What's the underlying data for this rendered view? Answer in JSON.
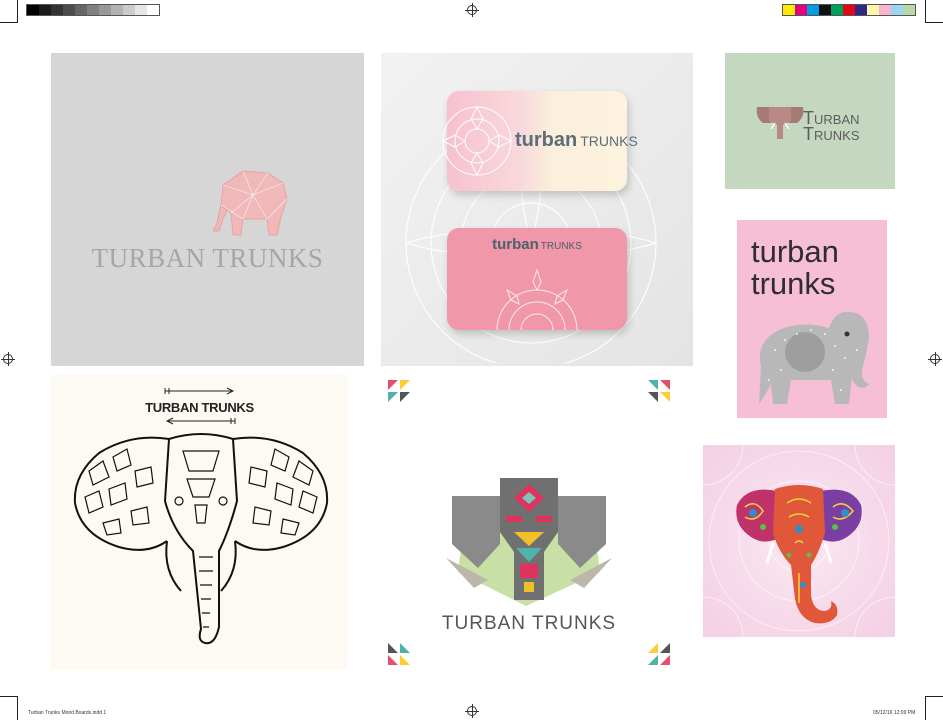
{
  "brand": {
    "name_upper": "TURBAN TRUNKS",
    "name_lower_1": "turban",
    "name_lower_2": "trunks",
    "card_word_1": "turban",
    "card_word_2": "TRUNKS",
    "logo_word_1": "URBAN",
    "logo_word_2": "RUNKS"
  },
  "slug": {
    "file": "Turban Trunks Mood Boards.indd   1",
    "datetime": "05/12/16   12:09 PM"
  },
  "colors": {
    "grayscale_bar": [
      "#000000",
      "#1a1a1a",
      "#333333",
      "#4d4d4d",
      "#666666",
      "#808080",
      "#999999",
      "#b3b3b3",
      "#cccccc",
      "#e6e6e6",
      "#ffffff"
    ],
    "color_bar": [
      "#ffec00",
      "#e5007d",
      "#00a0e0",
      "#111111",
      "#00a05a",
      "#e30613",
      "#2d2a87",
      "#fff7a8",
      "#f7b6cf",
      "#9bd6f0",
      "#b7d9a8"
    ],
    "palette_pink": "#f6bfd6",
    "palette_green": "#c4d7bf",
    "palette_gray": "#d6d6d6"
  }
}
